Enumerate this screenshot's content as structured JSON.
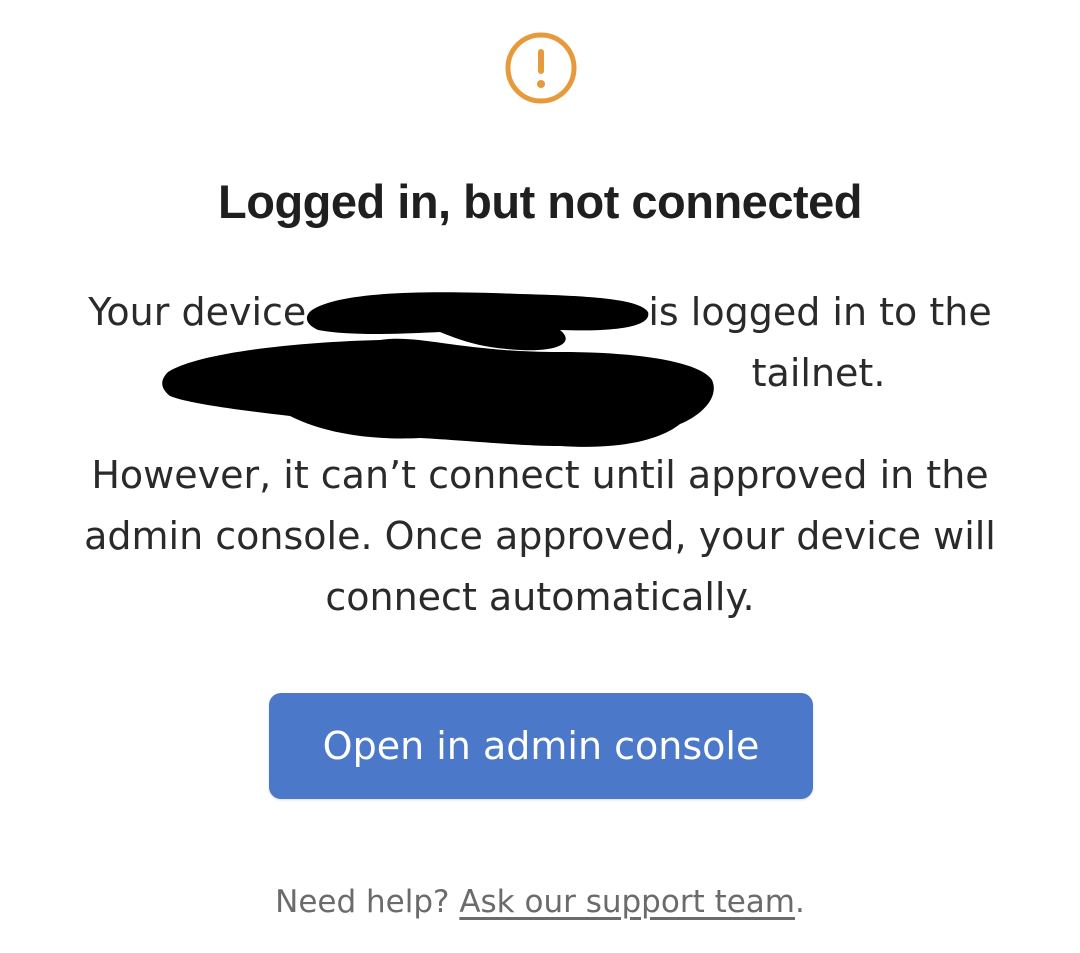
{
  "icon": "exclamation-circle-icon",
  "accent_color": "#e69a3c",
  "button_color": "#4b78c9",
  "title": "Logged in, but not connected",
  "message": {
    "line1_prefix": "Your device",
    "line1_suffix": " is logged in to the",
    "line2_suffix": " tailnet."
  },
  "approval_text": "However, it can’t connect until approved in the admin console. Once approved, your device will connect automatically.",
  "button_label": "Open in admin console",
  "help": {
    "prefix": "Need help? ",
    "link_text": "Ask our support team",
    "suffix": "."
  }
}
